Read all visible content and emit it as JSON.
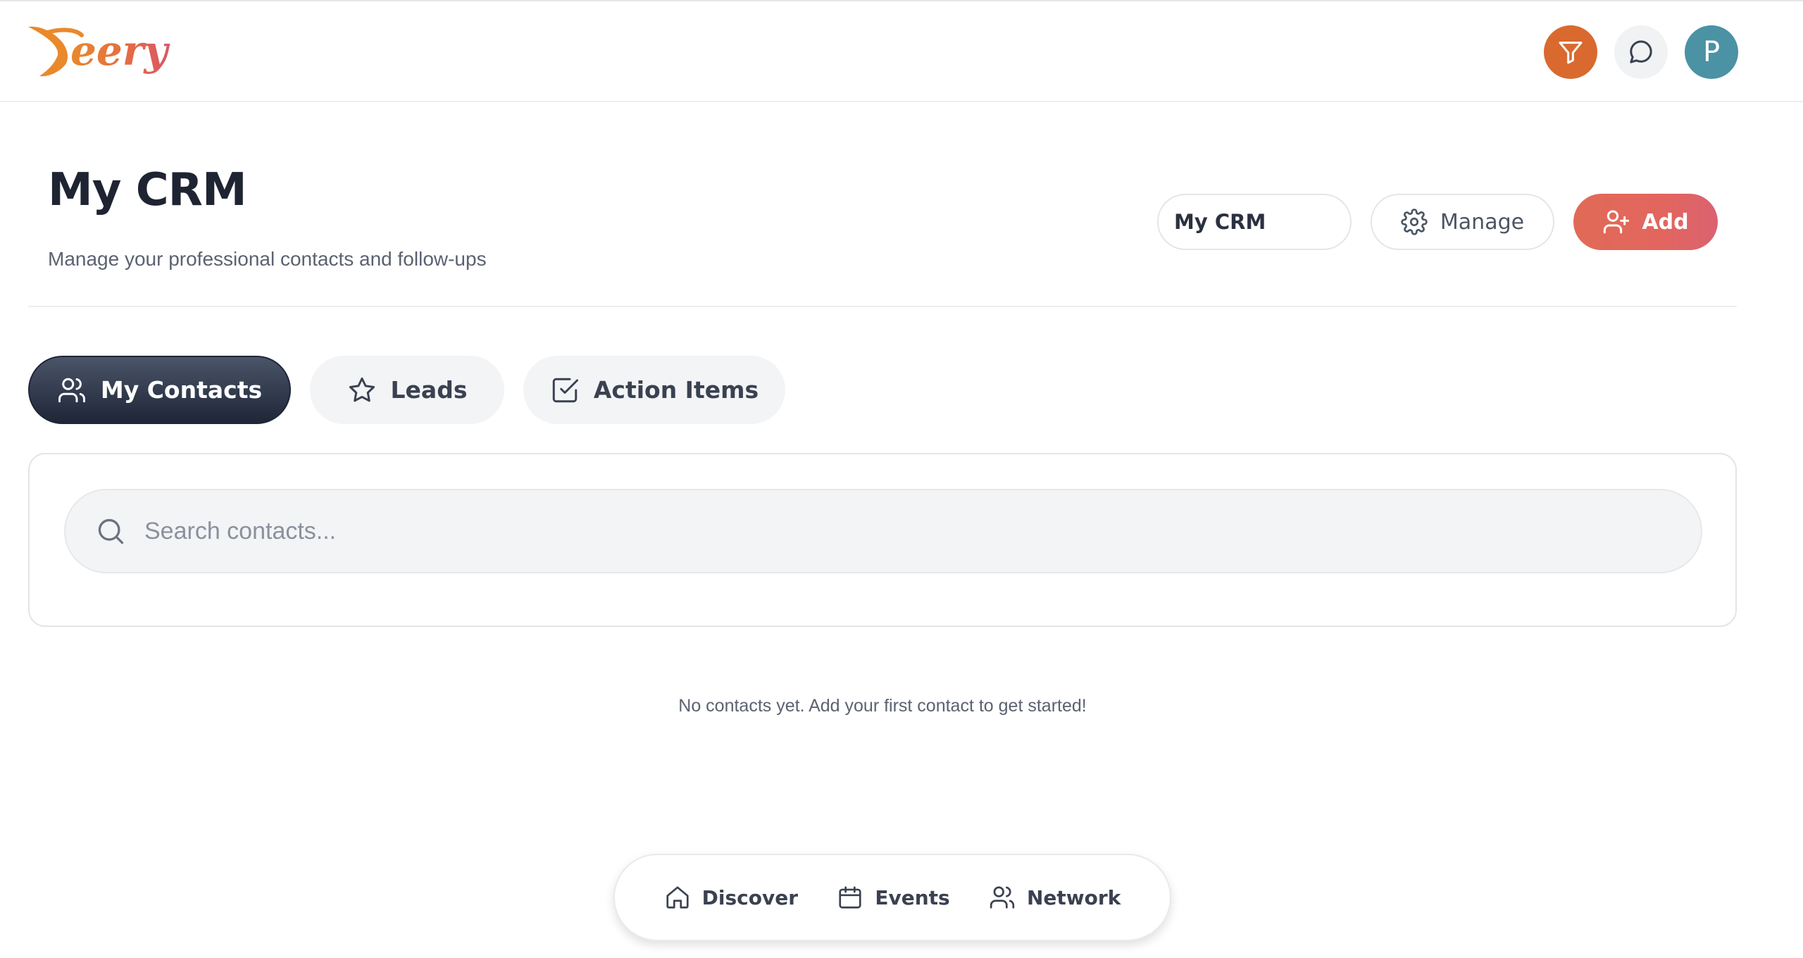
{
  "app": {
    "logo_text": "Yeery"
  },
  "topbar": {
    "filter_icon": "filter-icon",
    "chat_icon": "message-circle-icon",
    "avatar_initial": "P",
    "colors": {
      "filter_bg": "#d9692f",
      "avatar_bg": "#4a92a4"
    }
  },
  "header": {
    "title": "My CRM",
    "subtitle": "Manage your professional contacts and follow-ups",
    "crm_select_value": "My CRM",
    "manage_label": "Manage",
    "add_label": "Add"
  },
  "tabs": [
    {
      "label": "My Contacts",
      "icon": "users-icon",
      "active": true
    },
    {
      "label": "Leads",
      "icon": "star-icon",
      "active": false
    },
    {
      "label": "Action Items",
      "icon": "check-square-icon",
      "active": false
    }
  ],
  "search": {
    "placeholder": "Search contacts...",
    "value": ""
  },
  "empty_state": {
    "message": "No contacts yet. Add your first contact to get started!"
  },
  "bottom_nav": [
    {
      "label": "Discover",
      "icon": "home-icon"
    },
    {
      "label": "Events",
      "icon": "calendar-icon"
    },
    {
      "label": "Network",
      "icon": "users-icon"
    }
  ],
  "colors": {
    "accent": "#e2665e",
    "dark_tab": "#1e2638"
  }
}
